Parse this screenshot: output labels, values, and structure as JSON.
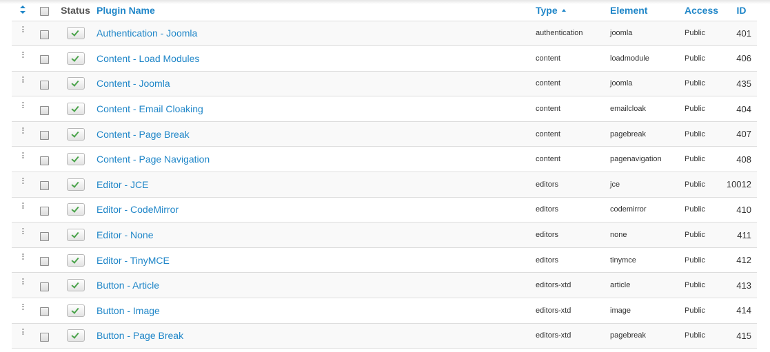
{
  "header": {
    "status": "Status",
    "name": "Plugin Name",
    "type": "Type",
    "element": "Element",
    "access": "Access",
    "id": "ID"
  },
  "rows": [
    {
      "name": "Authentication - Joomla",
      "type": "authentication",
      "element": "joomla",
      "access": "Public",
      "id": "401"
    },
    {
      "name": "Content - Load Modules",
      "type": "content",
      "element": "loadmodule",
      "access": "Public",
      "id": "406"
    },
    {
      "name": "Content - Joomla",
      "type": "content",
      "element": "joomla",
      "access": "Public",
      "id": "435"
    },
    {
      "name": "Content - Email Cloaking",
      "type": "content",
      "element": "emailcloak",
      "access": "Public",
      "id": "404"
    },
    {
      "name": "Content - Page Break",
      "type": "content",
      "element": "pagebreak",
      "access": "Public",
      "id": "407"
    },
    {
      "name": "Content - Page Navigation",
      "type": "content",
      "element": "pagenavigation",
      "access": "Public",
      "id": "408"
    },
    {
      "name": "Editor - JCE",
      "type": "editors",
      "element": "jce",
      "access": "Public",
      "id": "10012"
    },
    {
      "name": "Editor - CodeMirror",
      "type": "editors",
      "element": "codemirror",
      "access": "Public",
      "id": "410"
    },
    {
      "name": "Editor - None",
      "type": "editors",
      "element": "none",
      "access": "Public",
      "id": "411"
    },
    {
      "name": "Editor - TinyMCE",
      "type": "editors",
      "element": "tinymce",
      "access": "Public",
      "id": "412"
    },
    {
      "name": "Button - Article",
      "type": "editors-xtd",
      "element": "article",
      "access": "Public",
      "id": "413"
    },
    {
      "name": "Button - Image",
      "type": "editors-xtd",
      "element": "image",
      "access": "Public",
      "id": "414"
    },
    {
      "name": "Button - Page Break",
      "type": "editors-xtd",
      "element": "pagebreak",
      "access": "Public",
      "id": "415"
    }
  ],
  "status_icon": "check-icon",
  "colors": {
    "link": "#1f86c8",
    "check": "#4aa34a"
  }
}
